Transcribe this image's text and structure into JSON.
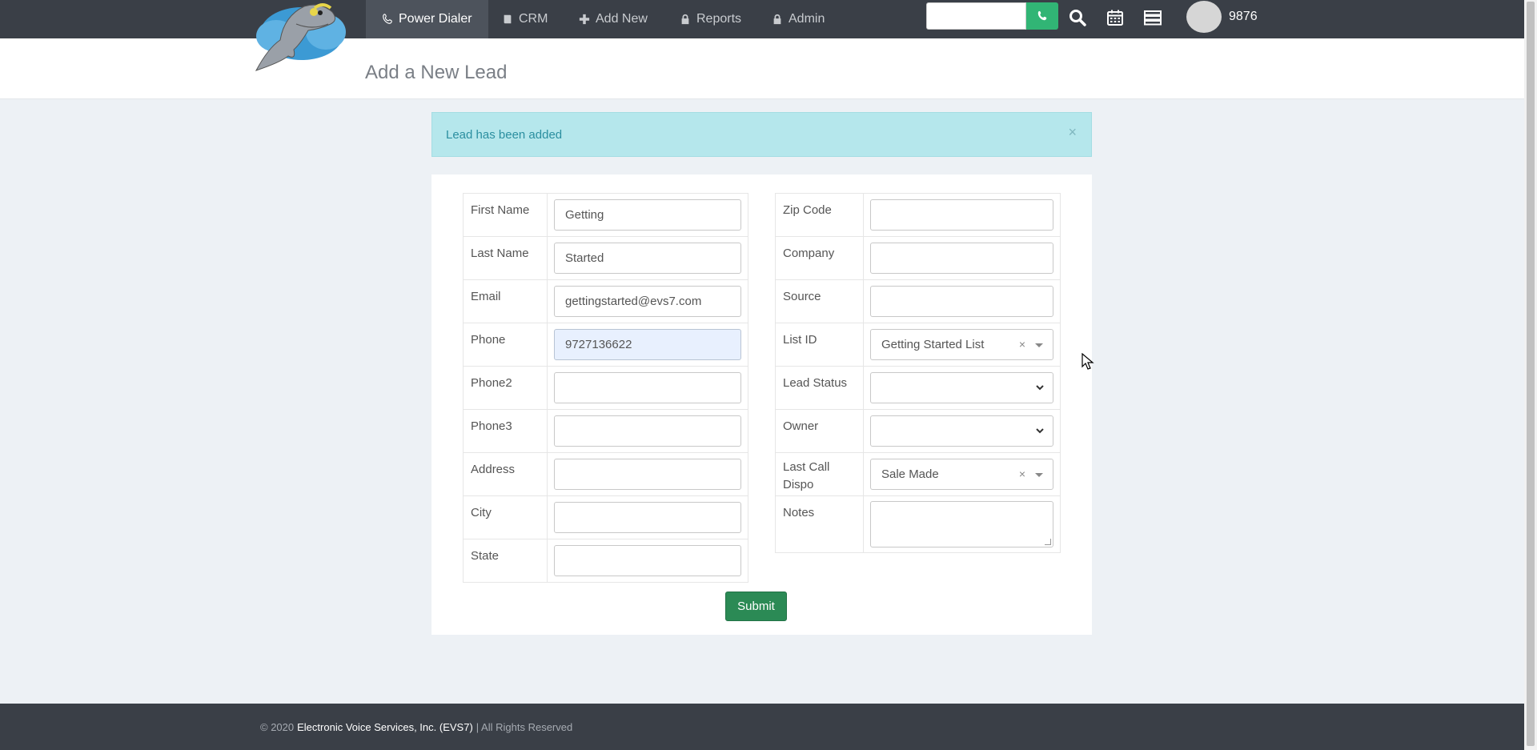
{
  "nav": {
    "items": [
      {
        "label": "Power Dialer",
        "icon": "phone-handset-icon",
        "active": true
      },
      {
        "label": "CRM",
        "icon": "book-icon",
        "active": false
      },
      {
        "label": "Add New",
        "icon": "plus-icon",
        "active": false
      },
      {
        "label": "Reports",
        "icon": "lock-icon",
        "active": false
      },
      {
        "label": "Admin",
        "icon": "lock-icon",
        "active": false
      }
    ],
    "search_value": "",
    "extension": "9876"
  },
  "page": {
    "title": "Add a New Lead"
  },
  "alert": {
    "message": "Lead has been added",
    "close": "×"
  },
  "form": {
    "left": [
      {
        "label": "First Name",
        "value": "Getting"
      },
      {
        "label": "Last Name",
        "value": "Started"
      },
      {
        "label": "Email",
        "value": "gettingstarted@evs7.com"
      },
      {
        "label": "Phone",
        "value": "9727136622"
      },
      {
        "label": "Phone2",
        "value": ""
      },
      {
        "label": "Phone3",
        "value": ""
      },
      {
        "label": "Address",
        "value": ""
      },
      {
        "label": "City",
        "value": ""
      },
      {
        "label": "State",
        "value": ""
      }
    ],
    "right": [
      {
        "label": "Zip Code",
        "value": ""
      },
      {
        "label": "Company",
        "value": ""
      },
      {
        "label": "Source",
        "value": ""
      },
      {
        "label": "List ID",
        "value": "Getting Started List"
      },
      {
        "label": "Lead Status",
        "value": ""
      },
      {
        "label": "Owner",
        "value": ""
      },
      {
        "label": "Last Call Dispo",
        "value": "Sale Made"
      },
      {
        "label": "Notes",
        "value": ""
      }
    ],
    "submit_label": "Submit"
  },
  "footer": {
    "prefix": "© 2020",
    "company": "Electronic Voice Services, Inc. (EVS7)",
    "suffix": "| All Rights Reserved"
  },
  "colors": {
    "nav_bg": "#3a3f47",
    "call_green": "#31b575",
    "submit_green": "#2b8a55",
    "alert_bg": "#b5e7ec"
  }
}
